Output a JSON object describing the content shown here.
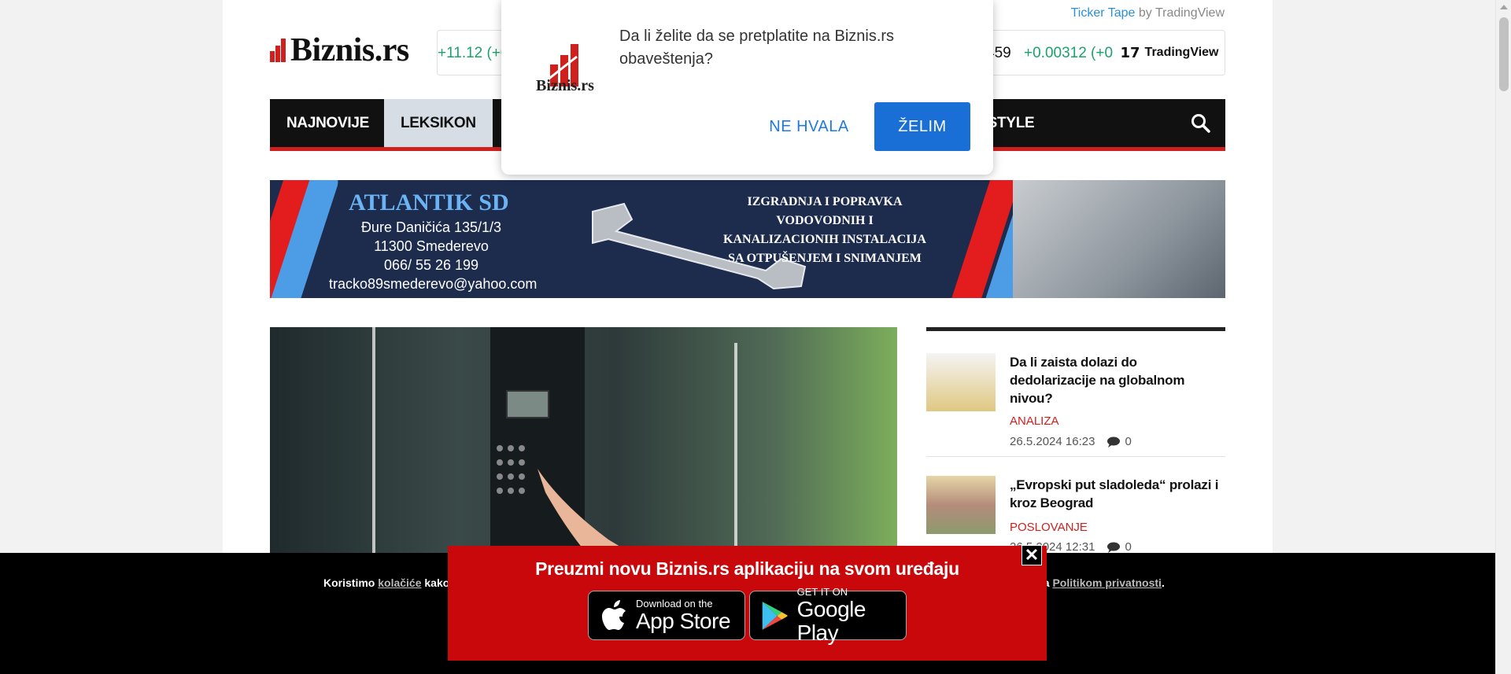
{
  "header": {
    "site_name": "Biznis.rs",
    "ticker_credit_link": "Ticker Tape",
    "ticker_credit_by": "by TradingView",
    "ticker": {
      "left_value": "+11.12 (+0",
      "mid_value": "459",
      "mid_change": "+0.00312 (+0",
      "brand": "TradingView"
    }
  },
  "nav": {
    "items": [
      {
        "label": "NAJNOVIJE",
        "active": false
      },
      {
        "label": "LEKSIKON",
        "active": true
      },
      {
        "label": "FESTYLE",
        "active": false
      }
    ]
  },
  "banner": {
    "company": "ATLANTIK SD",
    "address_lines": [
      "Đure Daničića 135/1/3",
      "11300 Smederevo",
      "066/ 55 26 199",
      "tracko89smederevo@yahoo.com"
    ],
    "service_lines": [
      "IZGRADNJA I POPRAVKA",
      "VODOVODNIH I",
      "KANALIZACIONIH INSTALACIJA",
      "SA OTPUŠENJEM I SNIMANJEM"
    ]
  },
  "sidebar": {
    "articles": [
      {
        "title": "Da li zaista dolazi do dedolarizacije na globalnom nivou?",
        "category": "ANALIZA",
        "date": "26.5.2024 16:23",
        "comments": "0"
      },
      {
        "title": "„Evropski put sladoleda“ prolazi i kroz Beograd",
        "category": "POSLOVANJE",
        "date": "26.5.2024 12:31",
        "comments": "0"
      }
    ]
  },
  "cookie": {
    "text_start": "Koristimo",
    "link_cookies": "kolačiće",
    "text_after_link": "kako",
    "text_end_prefix": "sa",
    "link_privacy": "Politikom privatnosti",
    "text_end_suffix": "."
  },
  "promo": {
    "title": "Preuzmi novu Biznis.rs aplikaciju na svom uređaju",
    "close_label": "✕",
    "appstore_small": "Download on the",
    "appstore_big": "App Store",
    "googleplay_small": "GET IT ON",
    "googleplay_big": "Google Play"
  },
  "modal": {
    "logo_text": "Biznis.rs",
    "question": "Da li želite da se pretplatite na Biznis.rs obaveštenja?",
    "decline": "NE HVALA",
    "accept": "ŽELIM"
  },
  "colors": {
    "brand_red": "#d0201e",
    "accept_blue": "#1a6fd6",
    "ticker_green": "#1aa36b"
  }
}
